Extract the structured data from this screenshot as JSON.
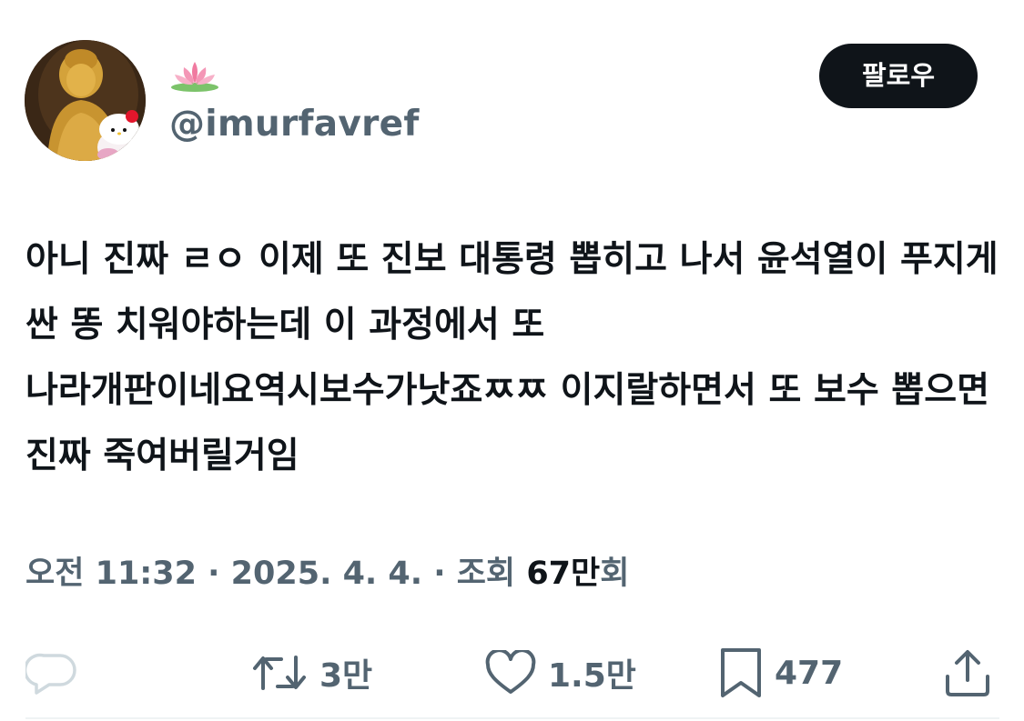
{
  "profile": {
    "avatar_icon": "avatar-buddha-hello-kitty",
    "display_name_icon": "lotus-emoji",
    "handle": "@imurfavref"
  },
  "follow_button": {
    "label": "팔로우"
  },
  "tweet": {
    "text": "아니 진짜 ㄹㅇ 이제 또 진보 대통령 뽑히고 나서 윤석열이 푸지게 싼 똥 치워야하는데 이 과정에서 또 나라개판이네요역시보수가낫죠ㅉㅉ 이지랄하면서 또 보수 뽑으면 진짜 죽여버릴거임"
  },
  "meta": {
    "time": "오전 11:32",
    "separator_1": " · ",
    "date": "2025. 4. 4.",
    "separator_2": " · ",
    "views_label": "조회 ",
    "views_count": "67만",
    "views_suffix": "회"
  },
  "actions": {
    "reply": {
      "icon": "reply-icon",
      "count": ""
    },
    "retweet": {
      "icon": "retweet-icon",
      "count": "3만"
    },
    "like": {
      "icon": "heart-icon",
      "count": "1.5만"
    },
    "bookmark": {
      "icon": "bookmark-icon",
      "count": "477"
    },
    "share": {
      "icon": "share-icon",
      "count": ""
    }
  },
  "colors": {
    "text_primary": "#0f1419",
    "text_secondary": "#536471",
    "follow_bg": "#0f1419",
    "divider": "#eff3f4"
  }
}
